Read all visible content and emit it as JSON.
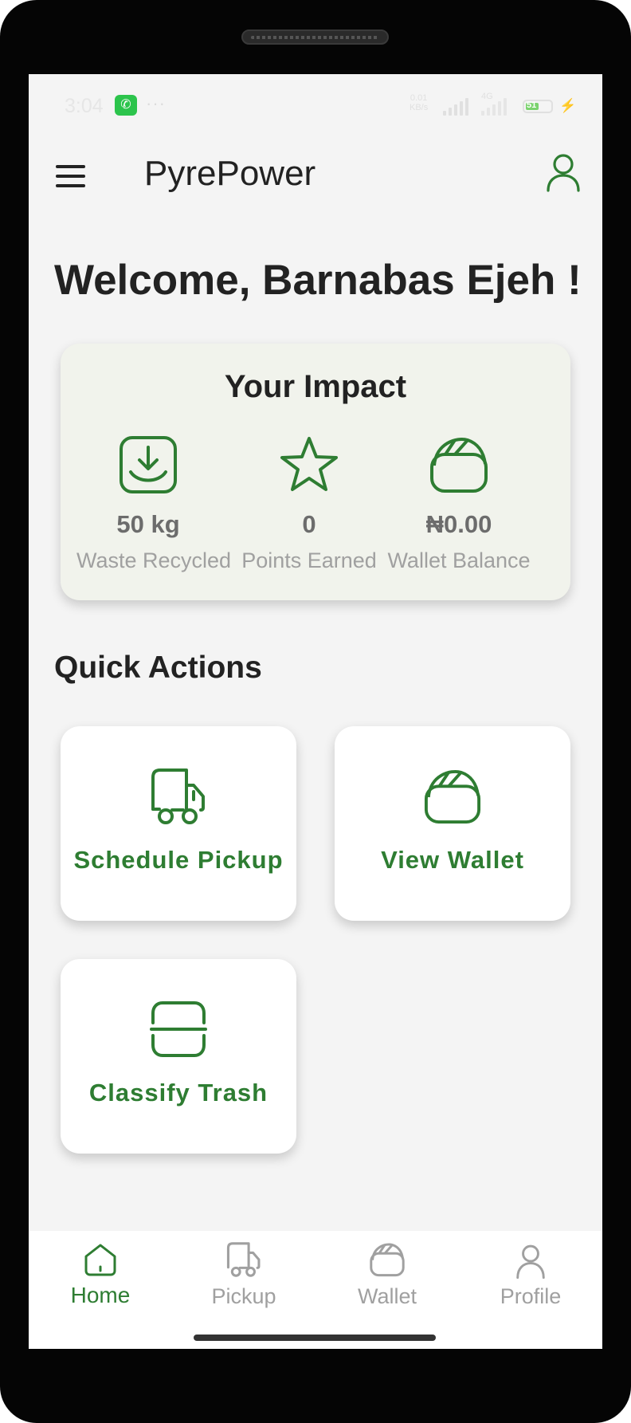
{
  "status_bar": {
    "time": "3:04",
    "whatsapp_glyph": "✆",
    "dots": "···",
    "net_speed_value": "0.01",
    "net_speed_unit": "KB/s",
    "network_type": "4G",
    "battery_level": "51"
  },
  "app_bar": {
    "title": "PyrePower"
  },
  "welcome": "Welcome, Barnabas Ejeh !",
  "impact": {
    "title": "Your Impact",
    "stats": [
      {
        "icon": "download-icon",
        "value": "50 kg",
        "label": "Waste Recycled"
      },
      {
        "icon": "star-icon",
        "value": "0",
        "label": "Points Earned"
      },
      {
        "icon": "wallet-icon",
        "value": "₦0.00",
        "label": "Wallet Balance"
      }
    ]
  },
  "quick_actions": {
    "title": "Quick Actions",
    "items": [
      {
        "icon": "truck-icon",
        "label": "Schedule Pickup"
      },
      {
        "icon": "wallet-icon",
        "label": "View Wallet"
      },
      {
        "icon": "scan-icon",
        "label": "Classify Trash"
      }
    ]
  },
  "bottom_nav": {
    "items": [
      {
        "icon": "home-icon",
        "label": "Home",
        "active": true
      },
      {
        "icon": "truck-icon",
        "label": "Pickup",
        "active": false
      },
      {
        "icon": "wallet-icon",
        "label": "Wallet",
        "active": false
      },
      {
        "icon": "person-icon",
        "label": "Profile",
        "active": false
      }
    ]
  },
  "colors": {
    "accent": "#2e7d32",
    "background": "#f4f4f4",
    "impact_card": "#f1f3ec",
    "muted_text": "#a0a0a0"
  }
}
